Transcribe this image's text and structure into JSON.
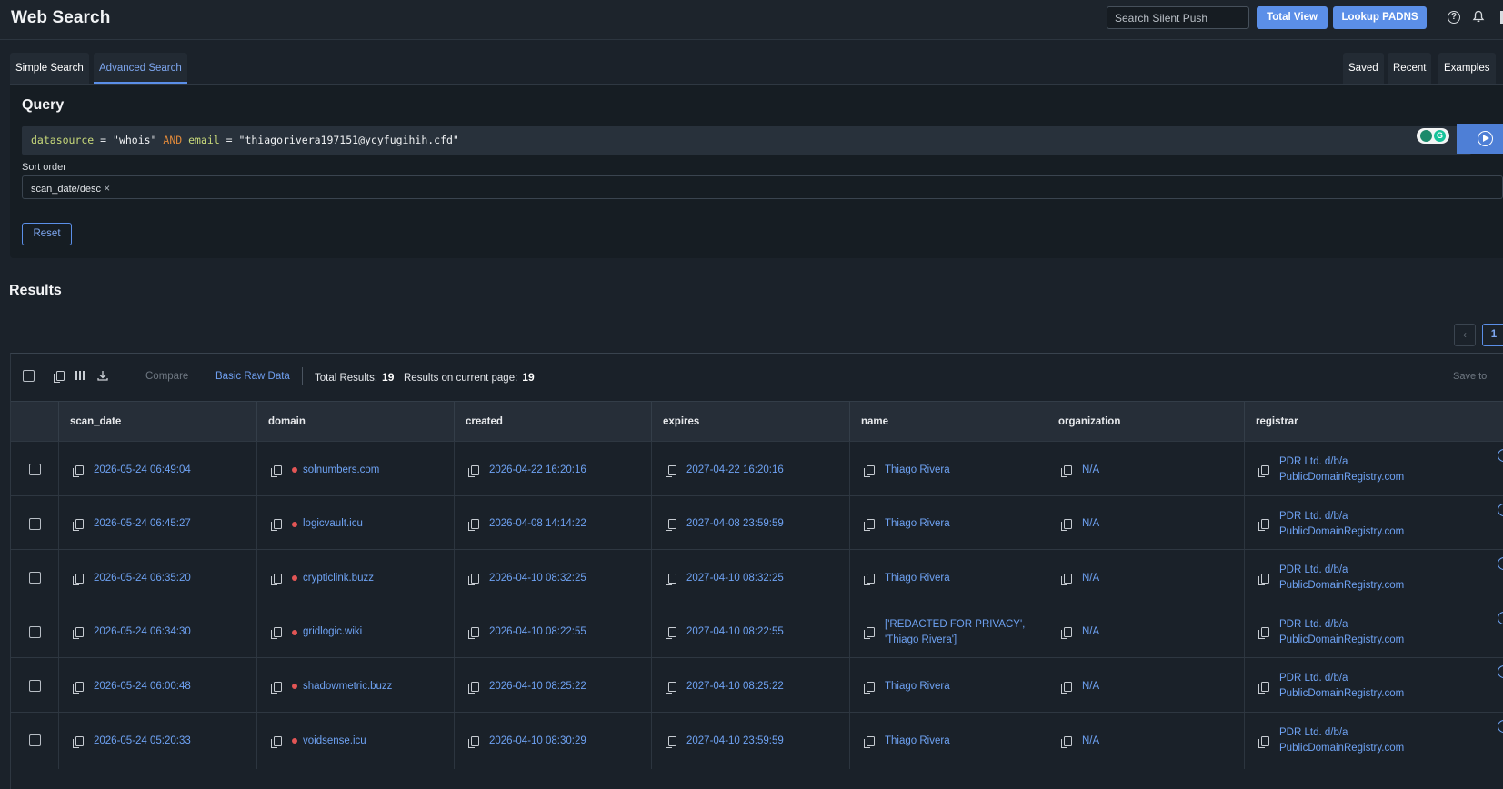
{
  "header": {
    "title": "Web Search",
    "search_placeholder": "Search Silent Push",
    "total_view_label": "Total View",
    "lookup_padns_label": "Lookup PADNS",
    "help_icon": "help-circle-icon",
    "bell_icon": "bell-icon"
  },
  "tabs": {
    "left": [
      {
        "label": "Simple Search",
        "active": false
      },
      {
        "label": "Advanced Search",
        "active": true
      }
    ],
    "right": [
      {
        "label": "Saved"
      },
      {
        "label": "Recent"
      },
      {
        "label": "Examples"
      }
    ]
  },
  "query": {
    "title": "Query",
    "tokens": {
      "f1": "datasource",
      "op1": " = ",
      "s1": "\"whois\"",
      "kw": " AND ",
      "f2": "email",
      "op2": " = ",
      "s2": "\"thiagorivera197151@ycyfugihih.cfd\""
    },
    "sort_label": "Sort order",
    "sort_chip": "scan_date/desc",
    "sort_chip_remove": "×",
    "reset_label": "Reset",
    "run_icon": "play-circle-icon"
  },
  "results": {
    "title": "Results",
    "pagination": {
      "prev": "‹",
      "current": "1"
    },
    "toolbar": {
      "compare": "Compare",
      "basic_raw": "Basic Raw Data",
      "total_label": "Total Results:",
      "total_value": "19",
      "page_label": "Results on current page:",
      "page_value": "19",
      "save_to": "Save to"
    },
    "columns": [
      "scan_date",
      "domain",
      "created",
      "expires",
      "name",
      "organization",
      "registrar"
    ],
    "rows": [
      {
        "scan_date": "2026-05-24 06:49:04",
        "domain": "solnumbers.com",
        "created": "2026-04-22 16:20:16",
        "expires": "2027-04-22 16:20:16",
        "name": "Thiago Rivera",
        "name2": "",
        "organization": "N/A",
        "registrar": "PDR Ltd. d/b/a",
        "registrar2": "PublicDomainRegistry.com"
      },
      {
        "scan_date": "2026-05-24 06:45:27",
        "domain": "logicvault.icu",
        "created": "2026-04-08 14:14:22",
        "expires": "2027-04-08 23:59:59",
        "name": "Thiago Rivera",
        "name2": "",
        "organization": "N/A",
        "registrar": "PDR Ltd. d/b/a",
        "registrar2": "PublicDomainRegistry.com"
      },
      {
        "scan_date": "2026-05-24 06:35:20",
        "domain": "crypticlink.buzz",
        "created": "2026-04-10 08:32:25",
        "expires": "2027-04-10 08:32:25",
        "name": "Thiago Rivera",
        "name2": "",
        "organization": "N/A",
        "registrar": "PDR Ltd. d/b/a",
        "registrar2": "PublicDomainRegistry.com"
      },
      {
        "scan_date": "2026-05-24 06:34:30",
        "domain": "gridlogic.wiki",
        "created": "2026-04-10 08:22:55",
        "expires": "2027-04-10 08:22:55",
        "name": "['REDACTED FOR PRIVACY',",
        "name2": "'Thiago Rivera']",
        "organization": "N/A",
        "registrar": "PDR Ltd. d/b/a",
        "registrar2": "PublicDomainRegistry.com"
      },
      {
        "scan_date": "2026-05-24 06:00:48",
        "domain": "shadowmetric.buzz",
        "created": "2026-04-10 08:25:22",
        "expires": "2027-04-10 08:25:22",
        "name": "Thiago Rivera",
        "name2": "",
        "organization": "N/A",
        "registrar": "PDR Ltd. d/b/a",
        "registrar2": "PublicDomainRegistry.com"
      },
      {
        "scan_date": "2026-05-24 05:20:33",
        "domain": "voidsense.icu",
        "created": "2026-04-10 08:30:29",
        "expires": "2027-04-10 23:59:59",
        "name": "Thiago Rivera",
        "name2": "",
        "organization": "N/A",
        "registrar": "PDR Ltd. d/b/a",
        "registrar2": "PublicDomainRegistry.com"
      }
    ]
  },
  "colors": {
    "accent": "#5b8fe8",
    "link": "#6ea2f3",
    "domain_dot": "#e25555",
    "background": "#1b222a"
  }
}
